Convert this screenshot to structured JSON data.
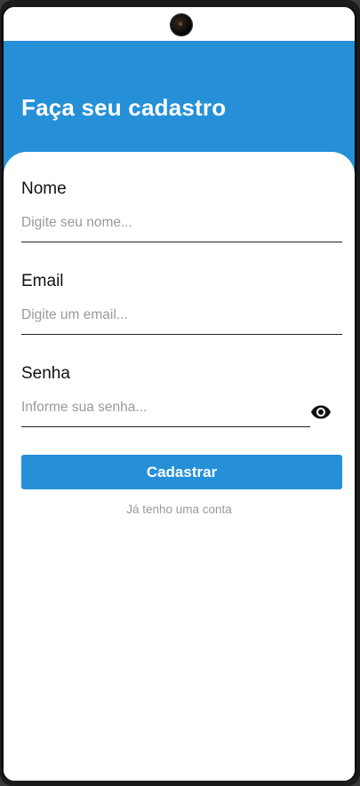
{
  "header": {
    "title": "Faça seu cadastro"
  },
  "form": {
    "name_label": "Nome",
    "name_placeholder": "Digite seu nome...",
    "email_label": "Email",
    "email_placeholder": "Digite um email...",
    "password_label": "Senha",
    "password_placeholder": "Informe sua senha...",
    "submit_label": "Cadastrar",
    "login_link": "Já tenho uma conta"
  },
  "icons": {
    "password_toggle": "eye-icon",
    "camera": "front-camera"
  },
  "colors": {
    "primary": "#2590d8",
    "background": "#ffffff",
    "placeholder": "#9a9a9a",
    "text": "#111111"
  }
}
